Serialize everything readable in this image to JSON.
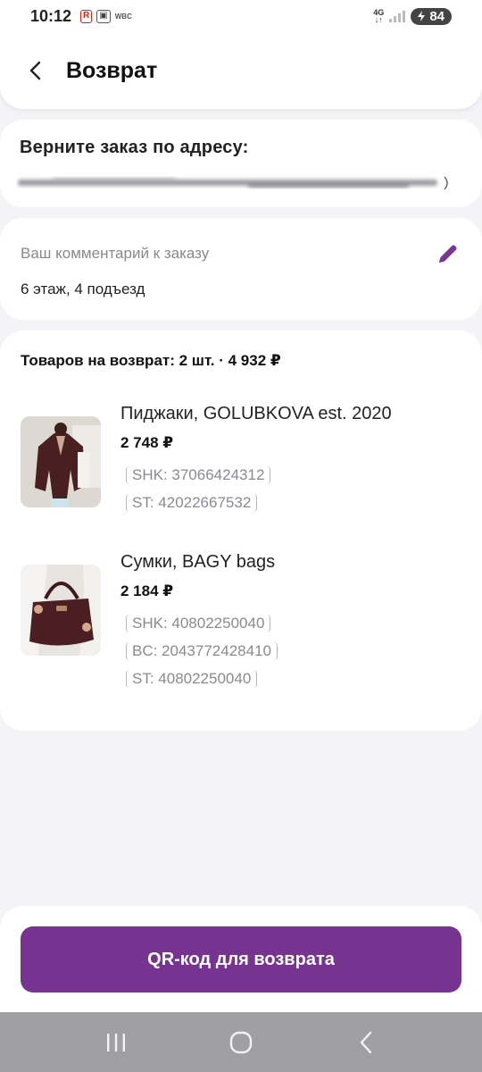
{
  "status_bar": {
    "time": "10:12",
    "carrier_label": "WBC",
    "network": "4G",
    "battery": "84"
  },
  "header": {
    "title": "Возврат"
  },
  "address": {
    "title": "Верните заказ по адресу:"
  },
  "comment": {
    "label": "Ваш комментарий к заказу",
    "value": "6 этаж, 4 подъезд"
  },
  "items": {
    "summary": "Товаров на возврат: 2 шт. · 4 932 ₽",
    "list": [
      {
        "name": "Пиджаки, GOLUBKOVA est. 2020",
        "price": "2 748 ₽",
        "codes": [
          "SHK: 37066424312",
          "ST: 42022667532"
        ]
      },
      {
        "name": "Сумки, BAGY bags",
        "price": "2 184 ₽",
        "codes": [
          "SHK: 40802250040",
          "BC: 2043772428410",
          "ST: 40802250040"
        ]
      }
    ]
  },
  "actions": {
    "qr_button": "QR-код для возврата"
  },
  "colors": {
    "accent": "#76338f",
    "nav_bar": "#a0a0a4"
  }
}
